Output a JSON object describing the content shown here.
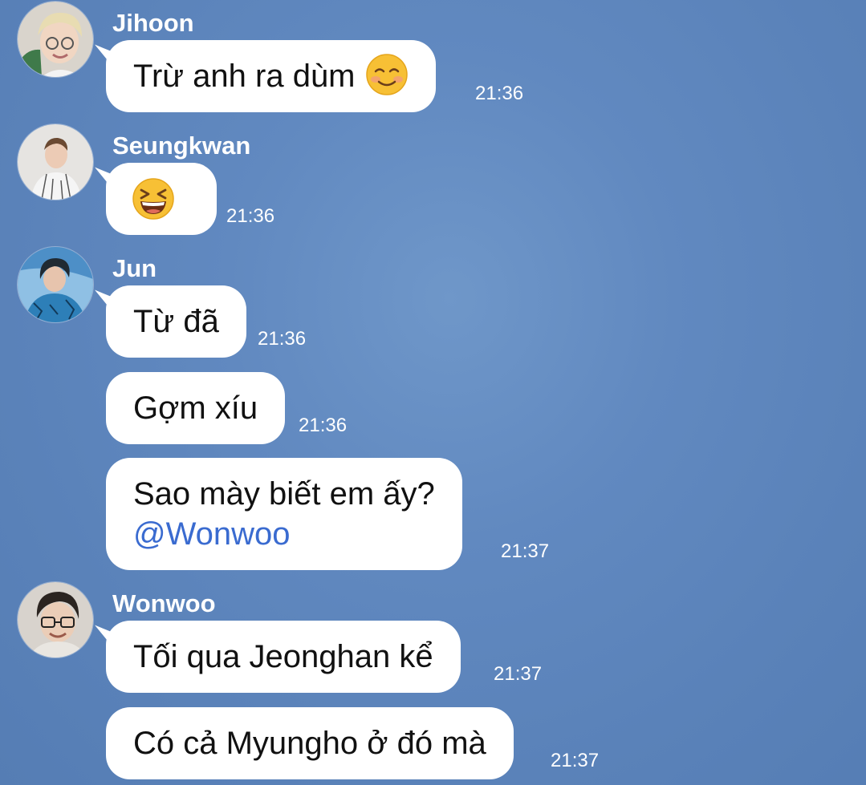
{
  "chat": {
    "messages": [
      {
        "sender": "Jihoon",
        "text": "Trừ anh ra dùm",
        "emoji": "smiling-face-icon",
        "time": "21:36"
      },
      {
        "sender": "Seungkwan",
        "text": "",
        "emoji": "grinning-squinting-face-icon",
        "time": "21:36"
      },
      {
        "sender": "Jun",
        "text": "Từ đã",
        "time": "21:36"
      },
      {
        "text": "Gợm xíu",
        "time": "21:36"
      },
      {
        "text": "Sao mày biết em ấy?",
        "mention": "@Wonwoo",
        "time": "21:37"
      },
      {
        "sender": "Wonwoo",
        "text": "Tối qua Jeonghan kể",
        "time": "21:37"
      },
      {
        "text": "Có cả Myungho ở đó mà",
        "time": "21:37"
      }
    ]
  },
  "colors": {
    "background": "#5a82b9",
    "bubble": "#ffffff",
    "mention": "#3a6bd0",
    "timestamp": "#ffffff"
  }
}
